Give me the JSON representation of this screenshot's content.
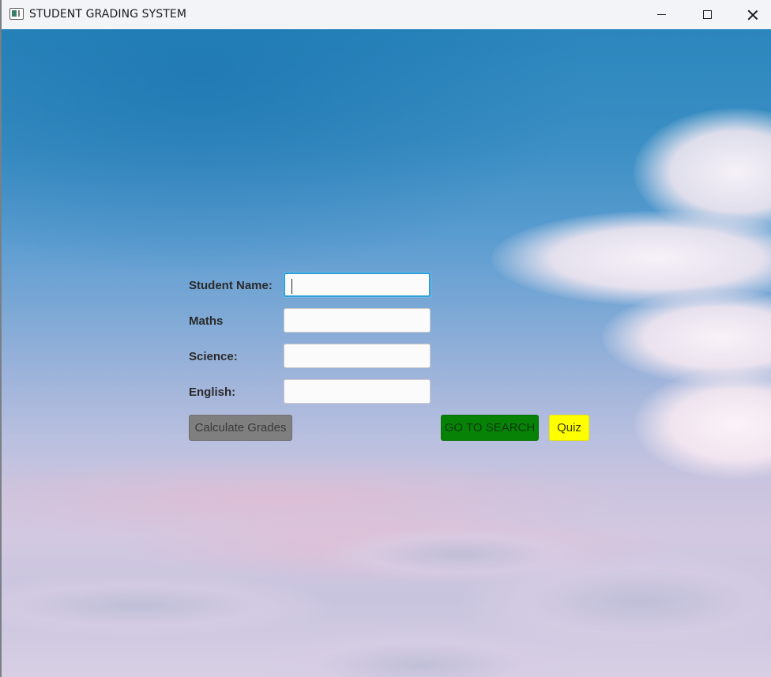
{
  "window": {
    "title": "STUDENT GRADING SYSTEM",
    "icon": "app-window-icon",
    "controls": [
      "minimize-icon",
      "maximize-icon",
      "close-icon"
    ]
  },
  "form": {
    "student_name_label": "Student Name:",
    "maths_label": "Maths",
    "science_label": "Science:",
    "english_label": "English:",
    "student_name_value": "",
    "maths_value": "",
    "science_value": "",
    "english_value": ""
  },
  "buttons": {
    "calculate_label": "Calculate Grades",
    "search_label": "GO TO SEARCH",
    "quiz_label": "Quiz"
  },
  "colors": {
    "calculate_bg": "#7f7f7f",
    "search_bg": "#078207",
    "quiz_bg": "#ffff00",
    "focus_border": "#2f9fd6"
  }
}
